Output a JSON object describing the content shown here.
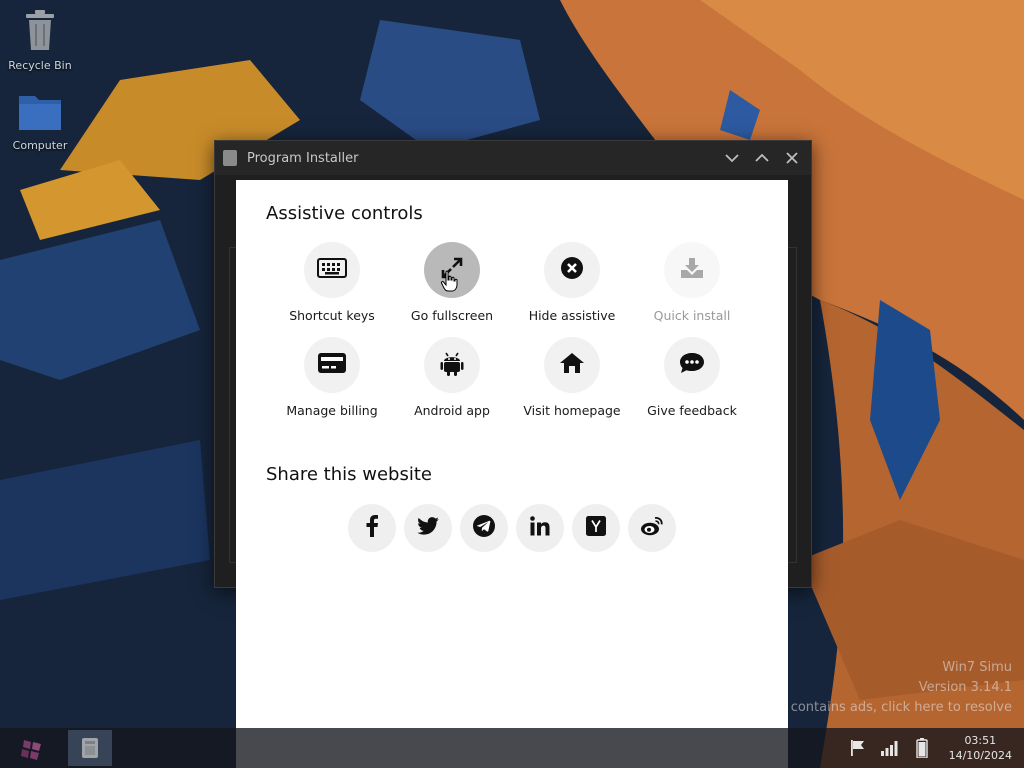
{
  "desktop": {
    "icons": [
      {
        "label": "Recycle Bin",
        "icon": "trash-icon"
      },
      {
        "label": "Computer",
        "icon": "folder-icon"
      }
    ]
  },
  "window": {
    "title": "Program Installer",
    "controls": [
      "minimize-icon",
      "maximize-icon",
      "close-icon"
    ]
  },
  "modal": {
    "assistive_title": "Assistive controls",
    "controls": [
      {
        "label": "Shortcut keys",
        "icon": "keyboard-icon"
      },
      {
        "label": "Go fullscreen",
        "icon": "expand-icon",
        "active": true
      },
      {
        "label": "Hide assistive",
        "icon": "close-circle-icon"
      },
      {
        "label": "Quick install",
        "icon": "download-icon",
        "disabled": true
      },
      {
        "label": "Manage billing",
        "icon": "credit-card-icon"
      },
      {
        "label": "Android app",
        "icon": "android-icon"
      },
      {
        "label": "Visit homepage",
        "icon": "home-icon"
      },
      {
        "label": "Give feedback",
        "icon": "chat-icon"
      }
    ],
    "share_title": "Share this website",
    "share": [
      "facebook-icon",
      "twitter-icon",
      "telegram-icon",
      "linkedin-icon",
      "hackernews-icon",
      "weibo-icon"
    ]
  },
  "watermark": {
    "line1": "Win7 Simu",
    "line2": "Version 3.14.1",
    "line3": "contains ads, click here to resolve"
  },
  "taskbar": {
    "time": "03:51",
    "date": "14/10/2024",
    "tray_icons": [
      "flag-icon",
      "signal-icon",
      "battery-icon"
    ]
  }
}
